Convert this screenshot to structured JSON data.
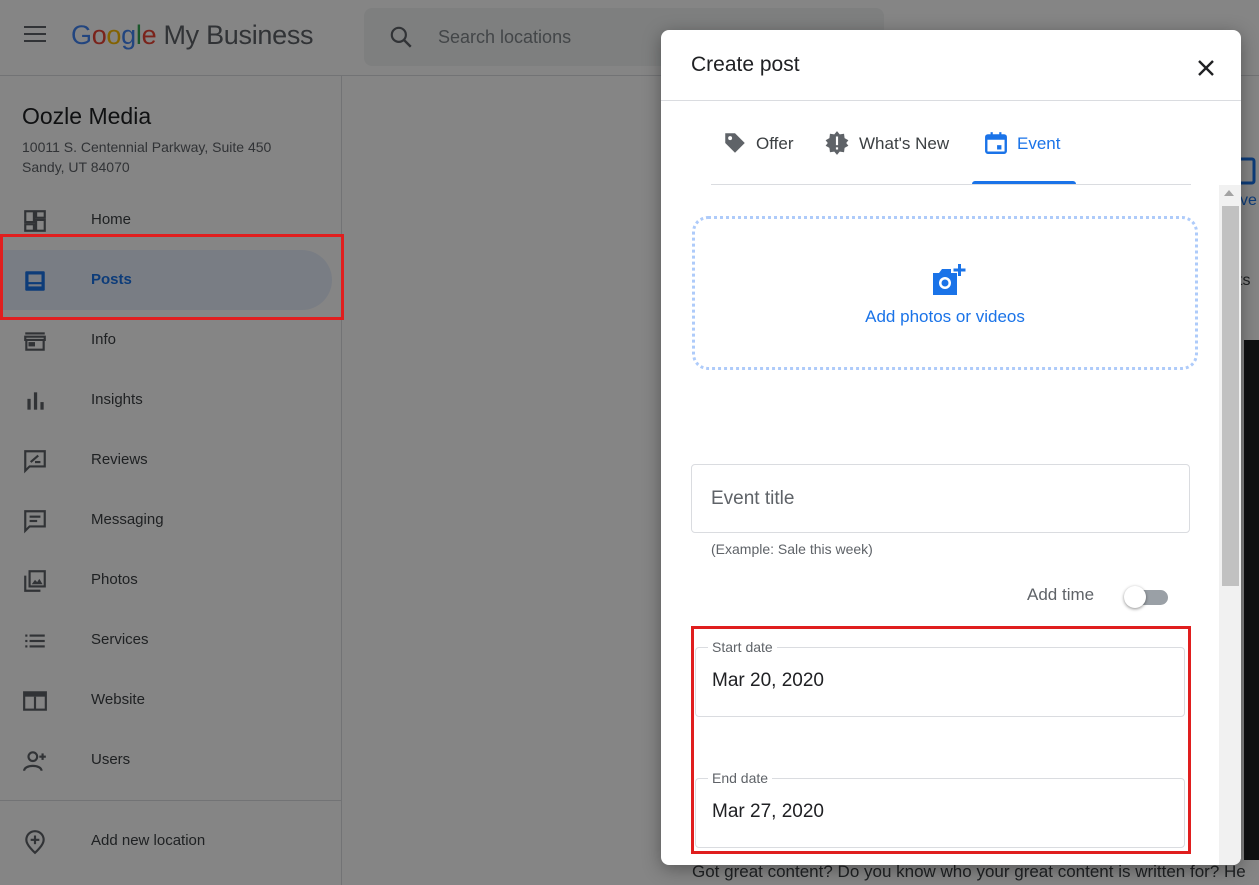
{
  "header": {
    "logo_google": "Google",
    "logo_product": "My Business",
    "search_placeholder": "Search locations"
  },
  "sidebar": {
    "business_name": "Oozle Media",
    "address_line1": "10011 S. Centennial Parkway, Suite 450",
    "address_line2": "Sandy, UT 84070",
    "items": [
      {
        "label": "Home",
        "icon": "dashboard-icon"
      },
      {
        "label": "Posts",
        "icon": "posts-icon",
        "active": true
      },
      {
        "label": "Info",
        "icon": "storefront-icon"
      },
      {
        "label": "Insights",
        "icon": "bar-chart-icon"
      },
      {
        "label": "Reviews",
        "icon": "rate-review-icon"
      },
      {
        "label": "Messaging",
        "icon": "message-icon"
      },
      {
        "label": "Photos",
        "icon": "photo-library-icon"
      },
      {
        "label": "Services",
        "icon": "list-icon"
      },
      {
        "label": "Website",
        "icon": "web-icon"
      },
      {
        "label": "Users",
        "icon": "person-add-icon"
      }
    ],
    "add_location": {
      "label": "Add new location",
      "icon": "add-location-icon"
    }
  },
  "background": {
    "card_fragment": "ve",
    "tab_fragment": "ts",
    "bottom_text": "Got great content? Do you know who your great content is written for? He"
  },
  "dialog": {
    "title": "Create post",
    "tabs": [
      {
        "label": "Offer",
        "icon": "offer-tag-icon"
      },
      {
        "label": "What's New",
        "icon": "whats-new-icon"
      },
      {
        "label": "Event",
        "icon": "event-calendar-icon",
        "active": true
      }
    ],
    "photo_upload_label": "Add photos or videos",
    "event_title_placeholder": "Event title",
    "event_title_value": "",
    "event_title_helper": "(Example: Sale this week)",
    "add_time_label": "Add time",
    "add_time_enabled": false,
    "start_date": {
      "label": "Start date",
      "value": "Mar 20, 2020"
    },
    "end_date": {
      "label": "End date",
      "value": "Mar 27, 2020"
    }
  },
  "colors": {
    "accent": "#1a73e8",
    "highlight_annotation": "#e01e1e",
    "scrim": "rgba(0,0,0,0.48)"
  }
}
